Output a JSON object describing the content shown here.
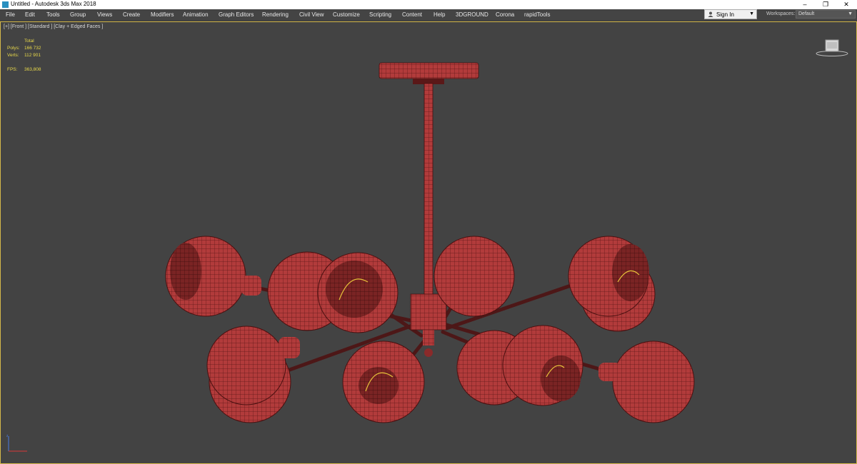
{
  "window": {
    "title": "Untitled - Autodesk 3ds Max 2018",
    "controls": [
      "–",
      "❐",
      "✕"
    ]
  },
  "menu": [
    "File",
    "Edit",
    "Tools",
    "Group",
    "Views",
    "Create",
    "Modifiers",
    "Animation",
    "Graph Editors",
    "Rendering",
    "Civil View",
    "Customize",
    "Scripting",
    "Content",
    "Help",
    "3DGROUND",
    "Corona",
    "rapidTools"
  ],
  "account": {
    "sign_in": "Sign In"
  },
  "workspaces": {
    "label": "Workspaces:",
    "value": "Default"
  },
  "viewport": {
    "label": "[+] [Front ] [Standard ] [Clay + Edged Faces ]",
    "stats": {
      "header": "Total",
      "polys_label": "Polys:",
      "polys": "166 732",
      "verts_label": "Verts:",
      "verts": "112 901",
      "fps_label": "FPS:",
      "fps": "363,808"
    }
  },
  "icons": [
    "app-icon",
    "user-icon",
    "viewcube-icon",
    "axis-tripod-icon"
  ],
  "colors": {
    "accent": "#d4b84a",
    "mesh": "#b43c3c",
    "stats": "#e8d84a"
  }
}
